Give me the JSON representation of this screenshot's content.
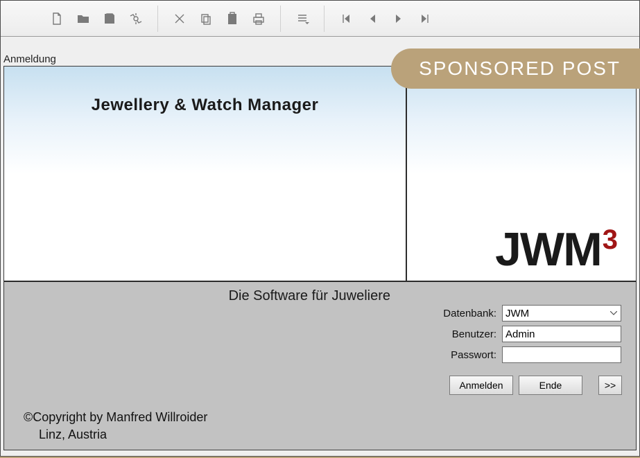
{
  "window_title": "Anmeldung",
  "app_title": "Jewellery & Watch Manager",
  "logo_main": "JWM",
  "logo_sup": "3",
  "subtitle": "Die Software für Juweliere",
  "form": {
    "db_label": "Datenbank:",
    "db_value": "JWM",
    "user_label": "Benutzer:",
    "user_value": "Admin",
    "pass_label": "Passwort:",
    "pass_value": ""
  },
  "buttons": {
    "login": "Anmelden",
    "end": "Ende",
    "more": ">>"
  },
  "copyright_line1": "©Copyright by Manfred Willroider",
  "copyright_line2": "Linz, Austria",
  "sponsored_label": "SPONSORED POST",
  "toolbar_icons": [
    "new-document",
    "open-folder",
    "save",
    "settings",
    "delete",
    "copy",
    "paste",
    "print",
    "list",
    "first",
    "prev",
    "next",
    "last"
  ]
}
